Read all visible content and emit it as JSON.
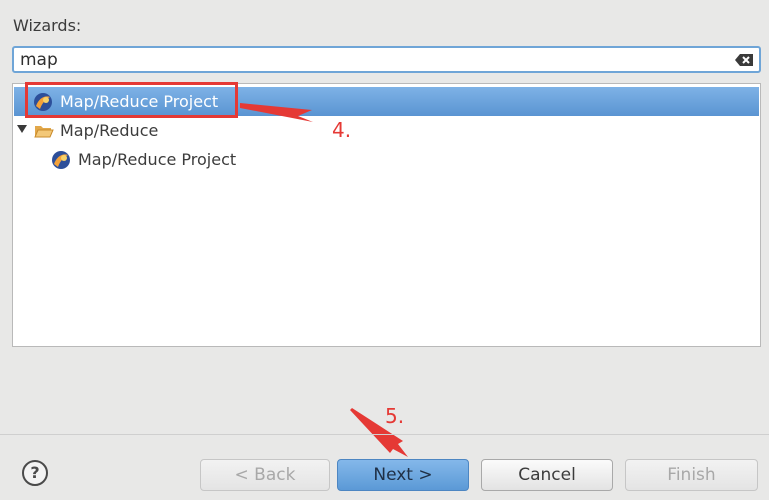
{
  "wizards_label": "Wizards:",
  "search": {
    "value": "map",
    "clear_icon": "clear-text-icon"
  },
  "tree": {
    "items": [
      {
        "label": "Map/Reduce Project",
        "icon": "mapreduce-project-icon",
        "selected": true
      },
      {
        "label": "Map/Reduce",
        "icon": "folder-open-icon",
        "expanded": true
      },
      {
        "label": "Map/Reduce Project",
        "icon": "mapreduce-project-icon"
      }
    ]
  },
  "annotations": {
    "step4": "4.",
    "step5": "5.",
    "color": "#e53935"
  },
  "footer": {
    "help_label": "?",
    "back_label": "< Back",
    "next_label": "Next >",
    "cancel_label": "Cancel",
    "finish_label": "Finish"
  },
  "colors": {
    "selection": "#6aa3de",
    "primary_button": "#6ba6df"
  }
}
